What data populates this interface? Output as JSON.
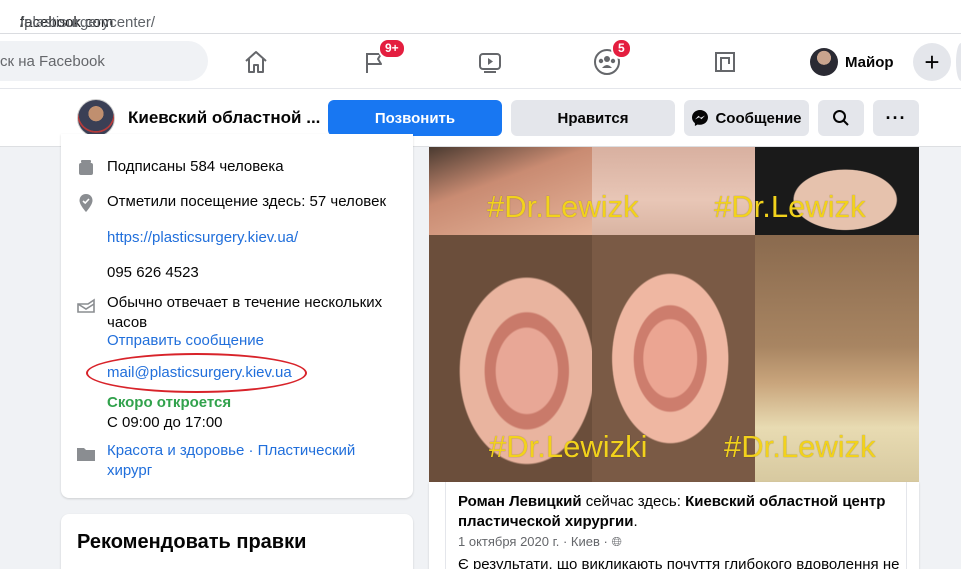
{
  "browser": {
    "url_domain": "facebook.com",
    "url_path": "/plastisurgerycenter/"
  },
  "topnav": {
    "search_placeholder": "ск на Facebook",
    "flag_badge": "9+",
    "groups_badge": "5",
    "profile_name": "Майор",
    "icons": [
      "home-icon",
      "pages-flag-icon",
      "watch-icon",
      "groups-icon",
      "gaming-icon",
      "plus-icon"
    ]
  },
  "page": {
    "name": "Киевский областной ...",
    "buttons": {
      "call": "Позвонить",
      "like": "Нравится",
      "message": "Сообщение"
    }
  },
  "intro": {
    "followers": "Подписаны 584 человека",
    "checkins": "Отметили посещение здесь: 57 человек",
    "website": "https://plasticsurgery.kiev.ua/",
    "phone": "095 626 4523",
    "response_time": "Обычно отвечает в течение нескольких часов",
    "send_message": "Отправить сообщение",
    "email": "mail@plasticsurgery.kiev.ua",
    "open_status": "Скоро откроется",
    "hours": "С 09:00 до 17:00",
    "category_1": "Красота и здоровье",
    "category_separator": " · ",
    "category_2": "Пластический хирург"
  },
  "suggest_edits": {
    "title": "Рекомендовать правки"
  },
  "collage": {
    "watermark_1": "#Dr.Lewizk",
    "watermark_2": "#Dr.Lewizk",
    "watermark_3": "#Dr.Lewizki",
    "watermark_4": "#Dr.Lewizk"
  },
  "post": {
    "author": "Роман Левицкий",
    "action": " сейчас здесь: ",
    "place": "Киевский областной центр пластической хирургии",
    "meta": "1 октября 2020 г. · Киев · ",
    "text": "Є результати, що викликають почуття глибокого вдоволення не"
  },
  "colors": {
    "primary": "#1877f2",
    "badge": "#e41e3f",
    "link": "#216fdb",
    "open_green": "#31a24c",
    "highlight_oval": "#d8232a",
    "watermark": "#f2d21c"
  }
}
